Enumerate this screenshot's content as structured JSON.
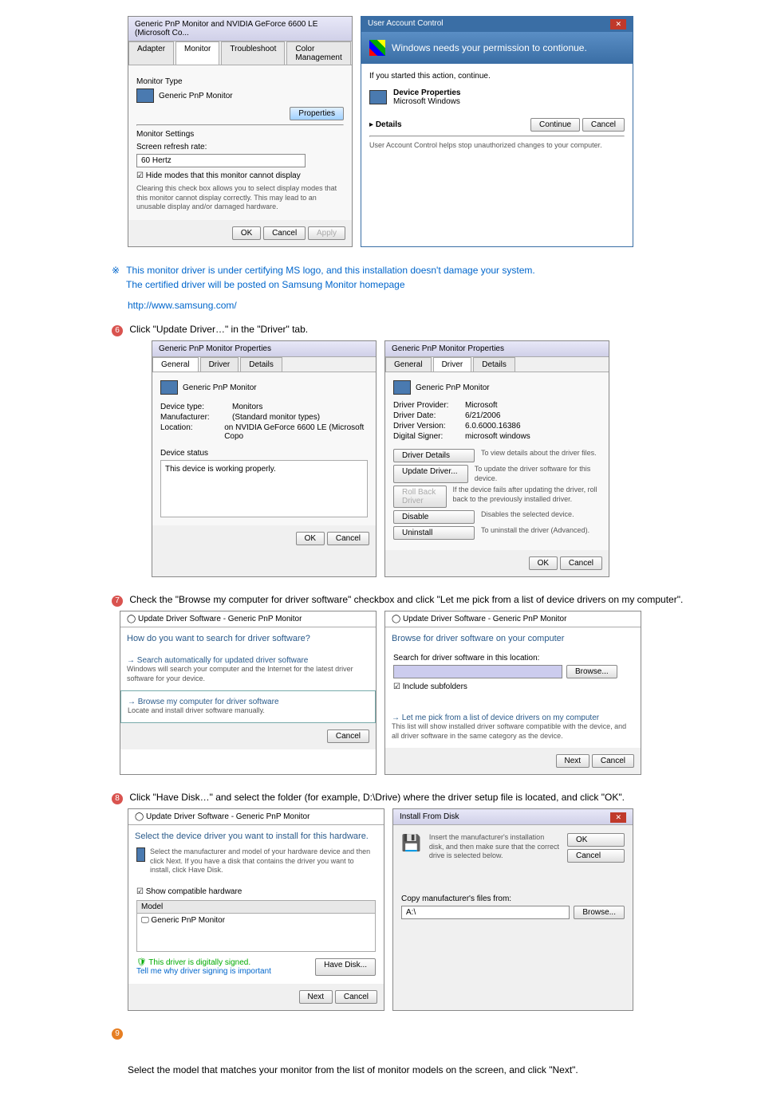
{
  "note": {
    "marker": "※",
    "line1": "This monitor driver is under certifying MS logo, and this installation doesn't damage your system.",
    "line2": "The certified driver will be posted on Samsung Monitor homepage",
    "link": "http://www.samsung.com/"
  },
  "step6": {
    "num": "6",
    "text": "Click \"Update Driver…\" in the \"Driver\" tab."
  },
  "step7": {
    "num": "7",
    "text": "Check the \"Browse my computer for driver software\" checkbox and click \"Let me pick from a list of device drivers on my computer\"."
  },
  "step8": {
    "num": "8",
    "text": "Click \"Have Disk…\" and select the folder (for example, D:\\Drive) where the driver setup file is located, and click \"OK\"."
  },
  "step9": {
    "num": "9",
    "text": "Select the model that matches your monitor from the list of monitor models on the screen, and click \"Next\"."
  },
  "monitor_props": {
    "title": "Generic PnP Monitor and NVIDIA GeForce 6600 LE (Microsoft Co...",
    "tabs": [
      "Adapter",
      "Monitor",
      "Troubleshoot",
      "Color Management"
    ],
    "monitor_type_label": "Monitor Type",
    "monitor_type": "Generic PnP Monitor",
    "properties_btn": "Properties",
    "settings_label": "Monitor Settings",
    "refresh_label": "Screen refresh rate:",
    "refresh_value": "60 Hertz",
    "hide_modes": "Hide modes that this monitor cannot display",
    "hide_desc": "Clearing this check box allows you to select display modes that this monitor cannot display correctly. This may lead to an unusable display and/or damaged hardware.",
    "ok": "OK",
    "cancel": "Cancel",
    "apply": "Apply"
  },
  "uac": {
    "title": "User Account Control",
    "banner": "Windows needs your permission to contionue.",
    "started": "If you started this action, continue.",
    "device_props": "Device Properties",
    "ms_windows": "Microsoft Windows",
    "details": "Details",
    "continue": "Continue",
    "cancel": "Cancel",
    "footer": "User Account Control helps stop unauthorized changes to your computer."
  },
  "pnp_general": {
    "title": "Generic PnP Monitor Properties",
    "tabs": [
      "General",
      "Driver",
      "Details"
    ],
    "name": "Generic PnP Monitor",
    "device_type_label": "Device type:",
    "device_type": "Monitors",
    "mfr_label": "Manufacturer:",
    "mfr": "(Standard monitor types)",
    "loc_label": "Location:",
    "loc": "on NVIDIA GeForce 6600 LE (Microsoft Copo",
    "status_label": "Device status",
    "status": "This device is working properly.",
    "ok": "OK",
    "cancel": "Cancel"
  },
  "pnp_driver": {
    "title": "Generic PnP Monitor Properties",
    "tabs": [
      "General",
      "Driver",
      "Details"
    ],
    "name": "Generic PnP Monitor",
    "provider_label": "Driver Provider:",
    "provider": "Microsoft",
    "date_label": "Driver Date:",
    "date": "6/21/2006",
    "version_label": "Driver Version:",
    "version": "6.0.6000.16386",
    "signer_label": "Digital Signer:",
    "signer": "microsoft windows",
    "details_btn": "Driver Details",
    "details_desc": "To view details about the driver files.",
    "update_btn": "Update Driver...",
    "update_desc": "To update the driver software for this device.",
    "rollback_btn": "Roll Back Driver",
    "rollback_desc": "If the device fails after updating the driver, roll back to the previously installed driver.",
    "disable_btn": "Disable",
    "disable_desc": "Disables the selected device.",
    "uninstall_btn": "Uninstall",
    "uninstall_desc": "To uninstall the driver (Advanced).",
    "ok": "OK",
    "cancel": "Cancel"
  },
  "wizard1": {
    "title": "Update Driver Software - Generic PnP Monitor",
    "heading": "How do you want to search for driver software?",
    "opt1_title": "Search automatically for updated driver software",
    "opt1_desc": "Windows will search your computer and the Internet for the latest driver software for your device.",
    "opt2_title": "Browse my computer for driver software",
    "opt2_desc": "Locate and install driver software manually.",
    "cancel": "Cancel"
  },
  "wizard2": {
    "title": "Update Driver Software - Generic PnP Monitor",
    "heading": "Browse for driver software on your computer",
    "search_label": "Search for driver software in this location:",
    "browse": "Browse...",
    "include": "Include subfolders",
    "opt_title": "Let me pick from a list of device drivers on my computer",
    "opt_desc": "This list will show installed driver software compatible with the device, and all driver software in the same category as the device.",
    "next": "Next",
    "cancel": "Cancel"
  },
  "wizard3": {
    "title": "Update Driver Software - Generic PnP Monitor",
    "heading": "Select the device driver you want to install for this hardware.",
    "instruct": "Select the manufacturer and model of your hardware device and then click Next. If you have a disk that contains the driver you want to install, click Have Disk.",
    "compat": "Show compatible hardware",
    "model_label": "Model",
    "model": "Generic PnP Monitor",
    "signed": "This driver is digitally signed.",
    "tell_me": "Tell me why driver signing is important",
    "have_disk": "Have Disk...",
    "next": "Next",
    "cancel": "Cancel"
  },
  "install_disk": {
    "title": "Install From Disk",
    "instruct": "Insert the manufacturer's installation disk, and then make sure that the correct drive is selected below.",
    "ok": "OK",
    "cancel": "Cancel",
    "copy_label": "Copy manufacturer's files from:",
    "path": "A:\\",
    "browse": "Browse..."
  }
}
